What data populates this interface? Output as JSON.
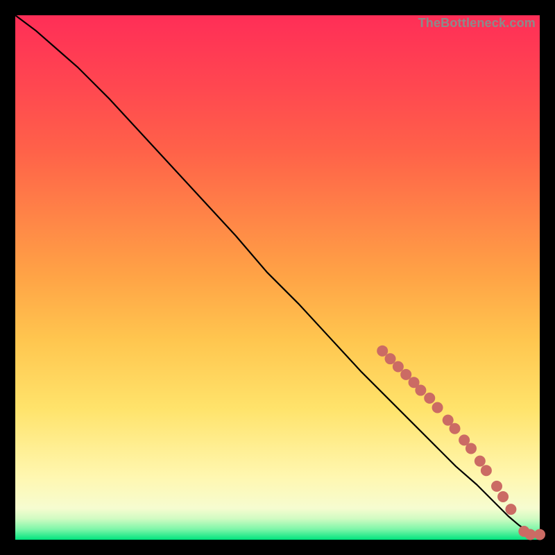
{
  "attribution": "TheBottleneck.com",
  "chart_data": {
    "type": "line",
    "title": "",
    "xlabel": "",
    "ylabel": "",
    "xlim": [
      0,
      100
    ],
    "ylim": [
      0,
      100
    ],
    "grid": false,
    "legend": false,
    "series": [
      {
        "name": "curve",
        "color": "#000000",
        "x": [
          0,
          4,
          8,
          12,
          18,
          24,
          30,
          36,
          42,
          48,
          54,
          60,
          66,
          72,
          76,
          80,
          84,
          88,
          92,
          94,
          96,
          98,
          100
        ],
        "values": [
          100,
          97,
          93.5,
          90,
          84,
          77.5,
          71,
          64.5,
          58,
          51,
          45,
          38.5,
          32,
          26,
          22,
          18,
          14,
          10.5,
          6.5,
          4.5,
          2.8,
          1.4,
          1.0
        ]
      }
    ],
    "markers": [
      {
        "name": "dots",
        "shape": "circle",
        "color": "#cb6b64",
        "radius_px": 8,
        "points": [
          {
            "x": 70.0,
            "y": 36.0
          },
          {
            "x": 71.5,
            "y": 34.5
          },
          {
            "x": 73.0,
            "y": 33.0
          },
          {
            "x": 74.5,
            "y": 31.5
          },
          {
            "x": 76.0,
            "y": 30.0
          },
          {
            "x": 77.3,
            "y": 28.5
          },
          {
            "x": 79.0,
            "y": 27.0
          },
          {
            "x": 80.5,
            "y": 25.2
          },
          {
            "x": 82.5,
            "y": 22.8
          },
          {
            "x": 83.8,
            "y": 21.2
          },
          {
            "x": 85.6,
            "y": 19.0
          },
          {
            "x": 86.9,
            "y": 17.4
          },
          {
            "x": 88.6,
            "y": 15.0
          },
          {
            "x": 89.8,
            "y": 13.2
          },
          {
            "x": 91.8,
            "y": 10.2
          },
          {
            "x": 93.0,
            "y": 8.2
          },
          {
            "x": 94.5,
            "y": 5.8
          },
          {
            "x": 97.0,
            "y": 1.6
          },
          {
            "x": 98.2,
            "y": 1.0
          },
          {
            "x": 100.0,
            "y": 1.0
          }
        ]
      }
    ]
  }
}
